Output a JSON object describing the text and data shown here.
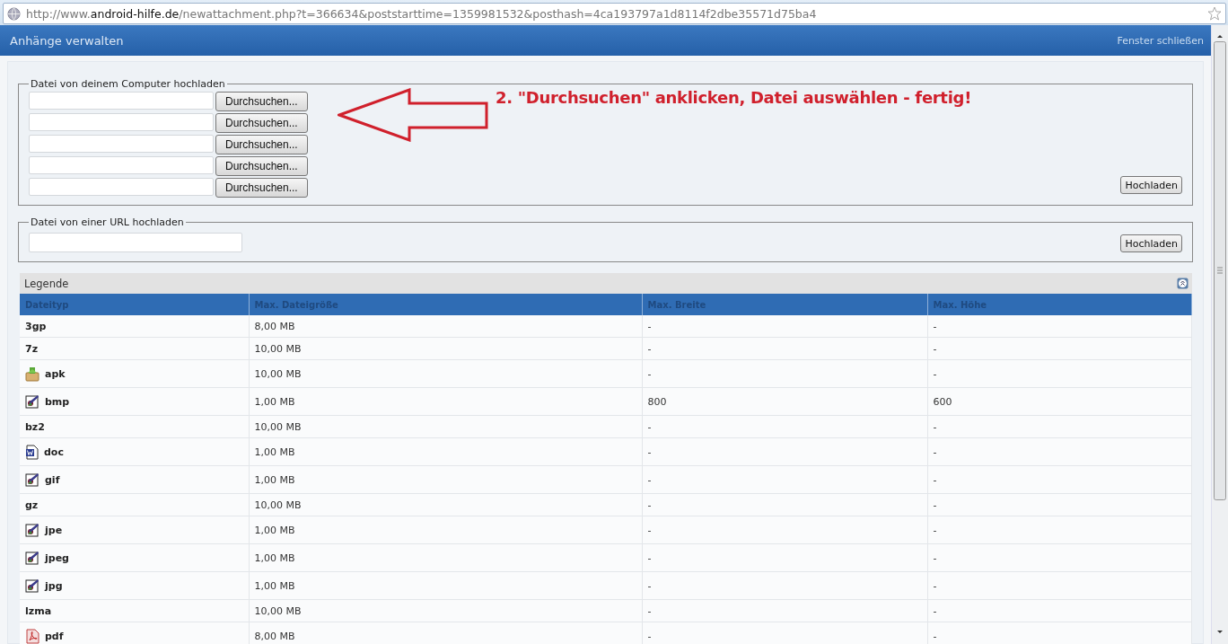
{
  "address_bar": {
    "url_prefix": "http://www.",
    "url_domain": "android-hilfe.de",
    "url_path": "/newattachment.php?t=366634&poststarttime=1359981532&posthash=4ca193797a1d8114f2dbe35571d75ba4"
  },
  "header": {
    "title": "Anhänge verwalten",
    "close_link": "Fenster schließen"
  },
  "upload_computer": {
    "legend": "Datei von deinem Computer hochladen",
    "browse_buttons": [
      "Durchsuchen...",
      "Durchsuchen...",
      "Durchsuchen...",
      "Durchsuchen...",
      "Durchsuchen..."
    ],
    "submit": "Hochladen"
  },
  "annotation": {
    "text": "2. \"Durchsuchen\" anklicken, Datei auswählen - fertig!"
  },
  "upload_url": {
    "legend": "Datei von einer URL hochladen",
    "submit": "Hochladen"
  },
  "legend_table": {
    "title": "Legende",
    "columns": [
      "Dateityp",
      "Max. Dateigröße",
      "Max. Breite",
      "Max. Höhe"
    ],
    "rows": [
      {
        "kind": "plain",
        "cells": [
          "3gp",
          "8,00 MB",
          "-",
          "-"
        ]
      },
      {
        "kind": "plain",
        "cells": [
          "7z",
          "10,00 MB",
          "-",
          "-"
        ]
      },
      {
        "kind": "package",
        "cells": [
          "apk",
          "10,00 MB",
          "-",
          "-"
        ]
      },
      {
        "kind": "image",
        "cells": [
          "bmp",
          "1,00 MB",
          "800",
          "600"
        ]
      },
      {
        "kind": "plain",
        "cells": [
          "bz2",
          "10,00 MB",
          "-",
          "-"
        ]
      },
      {
        "kind": "word",
        "cells": [
          "doc",
          "1,00 MB",
          "-",
          "-"
        ]
      },
      {
        "kind": "image",
        "cells": [
          "gif",
          "1,00 MB",
          "-",
          "-"
        ]
      },
      {
        "kind": "plain",
        "cells": [
          "gz",
          "10,00 MB",
          "-",
          "-"
        ]
      },
      {
        "kind": "image",
        "cells": [
          "jpe",
          "1,00 MB",
          "-",
          "-"
        ]
      },
      {
        "kind": "image",
        "cells": [
          "jpeg",
          "1,00 MB",
          "-",
          "-"
        ]
      },
      {
        "kind": "image",
        "cells": [
          "jpg",
          "1,00 MB",
          "-",
          "-"
        ]
      },
      {
        "kind": "plain",
        "cells": [
          "lzma",
          "10,00 MB",
          "-",
          "-"
        ]
      },
      {
        "kind": "pdf",
        "cells": [
          "pdf",
          "8,00 MB",
          "-",
          "-"
        ]
      }
    ]
  }
}
